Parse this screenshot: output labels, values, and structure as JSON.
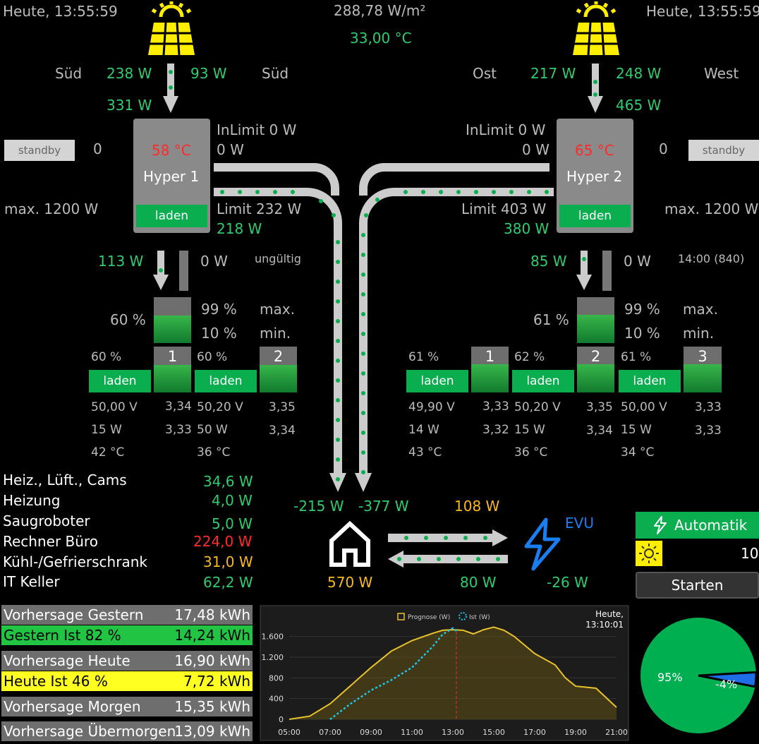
{
  "header": {
    "time_left": "Heute, 13:55:59",
    "time_right": "Heute, 13:55:59",
    "irradiance": "288,78 W/m²",
    "temperature": "33,00 °C"
  },
  "hyper1": {
    "label_left": "Süd",
    "label_right": "Süd",
    "pv_left": "238 W",
    "pv_right": "93 W",
    "pv_total": "331 W",
    "standby": "standby",
    "standby_value": "0",
    "temp": "58 °C",
    "name": "Hyper 1",
    "mode": "laden",
    "inlimit": "InLimit 0 W",
    "in_value": "0 W",
    "limit": "Limit 232 W",
    "out_value": "218 W",
    "max": "max. 1200 W",
    "charge_power": "113 W",
    "discharge_power": "0 W",
    "status": "ungültig",
    "soc": "60 %",
    "soc_fraction": 0.6,
    "soc_max": "99 %",
    "soc_min": "10 %",
    "max_label": "max.",
    "min_label": "min.",
    "packs": [
      {
        "soc": "60 %",
        "mode": "laden",
        "num": "1",
        "fill": 0.6,
        "voltage": "50,00 V",
        "power": "15 W",
        "temp": "42 °C",
        "cell_hi": "3,34",
        "cell_lo": "3,33"
      },
      {
        "soc": "60 %",
        "mode": "laden",
        "num": "2",
        "fill": 0.6,
        "voltage": "50,20 V",
        "power": "50 W",
        "temp": "36 °C",
        "cell_hi": "3,35",
        "cell_lo": "3,34"
      }
    ]
  },
  "hyper2": {
    "label_left": "Ost",
    "label_right": "West",
    "pv_left": "217 W",
    "pv_right": "248 W",
    "pv_total": "465 W",
    "standby": "standby",
    "standby_value": "0",
    "temp": "65 °C",
    "name": "Hyper 2",
    "mode": "laden",
    "inlimit": "InLimit 0 W",
    "in_value": "0 W",
    "limit": "Limit 403 W",
    "out_value": "380 W",
    "max": "max. 1200 W",
    "charge_power": "85 W",
    "discharge_power": "0 W",
    "status": "14:00 (840)",
    "soc": "61 %",
    "soc_fraction": 0.61,
    "soc_max": "99 %",
    "soc_min": "10 %",
    "max_label": "max.",
    "min_label": "min.",
    "packs": [
      {
        "soc": "61 %",
        "mode": "laden",
        "num": "1",
        "fill": 0.61,
        "voltage": "49,90 V",
        "power": "14 W",
        "temp": "43 °C",
        "cell_hi": "3,33",
        "cell_lo": "3,32"
      },
      {
        "soc": "62 %",
        "mode": "laden",
        "num": "2",
        "fill": 0.62,
        "voltage": "50,20 V",
        "power": "15 W",
        "temp": "36 °C",
        "cell_hi": "3,35",
        "cell_lo": "3,34"
      },
      {
        "soc": "61 %",
        "mode": "laden",
        "num": "3",
        "fill": 0.61,
        "voltage": "50,00 V",
        "power": "15 W",
        "temp": "34 °C",
        "cell_hi": "3,33",
        "cell_lo": "3,33"
      }
    ]
  },
  "consumers": [
    {
      "name": "Heiz., Lüft., Cams",
      "value": "34,6 W",
      "color": "#2ecc71"
    },
    {
      "name": "Heizung",
      "value": "4,0 W",
      "color": "#2ecc71"
    },
    {
      "name": "Saugroboter",
      "value": "5,0 W",
      "color": "#2ecc71"
    },
    {
      "name": "Rechner Büro",
      "value": "224,0 W",
      "color": "#ff2a2a"
    },
    {
      "name": "Kühl-/Gefrierschrank",
      "value": "31,0 W",
      "color": "#f9b91a"
    },
    {
      "name": "IT Keller",
      "value": "62,2 W",
      "color": "#2ecc71"
    }
  ],
  "house": {
    "flow1": "-215 W",
    "flow2": "-377 W",
    "consumption": "570 W"
  },
  "grid": {
    "feed_in": "108 W",
    "draw": "80 W",
    "net": "-26 W",
    "label": "EVU"
  },
  "automation": {
    "label": "Automatik",
    "value": "10",
    "start_label": "Starten"
  },
  "forecast": [
    {
      "label": "Vorhersage Gestern",
      "value": "17,48 kWh",
      "bg": "#6e6e6e",
      "fg": "#fff"
    },
    {
      "label": "Gestern Ist  82 %",
      "value": "14,24 kWh",
      "bg": "#22c443",
      "fg": "#000"
    },
    {
      "label": "Vorhersage Heute",
      "value": "16,90 kWh",
      "bg": "#6e6e6e",
      "fg": "#fff"
    },
    {
      "label": "Heute Ist    46 %",
      "value": "7,72 kWh",
      "bg": "#ffff22",
      "fg": "#000"
    },
    {
      "label": "Vorhersage Morgen",
      "value": "15,35 kWh",
      "bg": "#6e6e6e",
      "fg": "#fff"
    },
    {
      "label": "Vorhersage Übermorgen",
      "value": "13,09 kWh",
      "bg": "#6e6e6e",
      "fg": "#fff"
    }
  ],
  "chart_data": [
    {
      "type": "line",
      "title": "Heute,\n13:10:01",
      "legend": [
        "Prognose (W)",
        "Ist (W)"
      ],
      "x_ticks": [
        "05:00",
        "07:00",
        "09:00",
        "11:00",
        "13:00",
        "15:00",
        "17:00",
        "19:00",
        "21:00"
      ],
      "y_ticks": [
        "0",
        "400",
        "800",
        "1.200",
        "1.600"
      ],
      "ylim": [
        0,
        1800
      ],
      "xlim": [
        5,
        21
      ],
      "now_marker": 13.17,
      "series": [
        {
          "name": "Prognose (W)",
          "color": "#e8c22a",
          "x": [
            5,
            6,
            7,
            8,
            9,
            10,
            11,
            12,
            12.5,
            13,
            13.5,
            14,
            14.5,
            15,
            15.5,
            16,
            17,
            18,
            18.5,
            19,
            19.5,
            20,
            21
          ],
          "y": [
            0,
            60,
            300,
            650,
            1000,
            1320,
            1520,
            1660,
            1720,
            1730,
            1720,
            1650,
            1730,
            1780,
            1720,
            1600,
            1270,
            1050,
            800,
            640,
            620,
            600,
            230
          ]
        },
        {
          "name": "Ist (W)",
          "color": "#1ec8ec",
          "x": [
            7,
            7.5,
            8,
            9,
            10,
            11,
            11.5,
            12,
            12.5,
            13,
            13.2
          ],
          "y": [
            0,
            150,
            300,
            560,
            760,
            1000,
            1200,
            1400,
            1640,
            1760,
            1700
          ]
        }
      ]
    },
    {
      "type": "pie",
      "slices": [
        {
          "label": "95%",
          "value": 95,
          "color": "#00b050"
        },
        {
          "label": "-4%",
          "value": 4,
          "color": "#1e6ee8"
        }
      ]
    }
  ],
  "icons": [
    "solar-panel-icon",
    "house-icon",
    "lightning-icon",
    "sun-icon"
  ]
}
